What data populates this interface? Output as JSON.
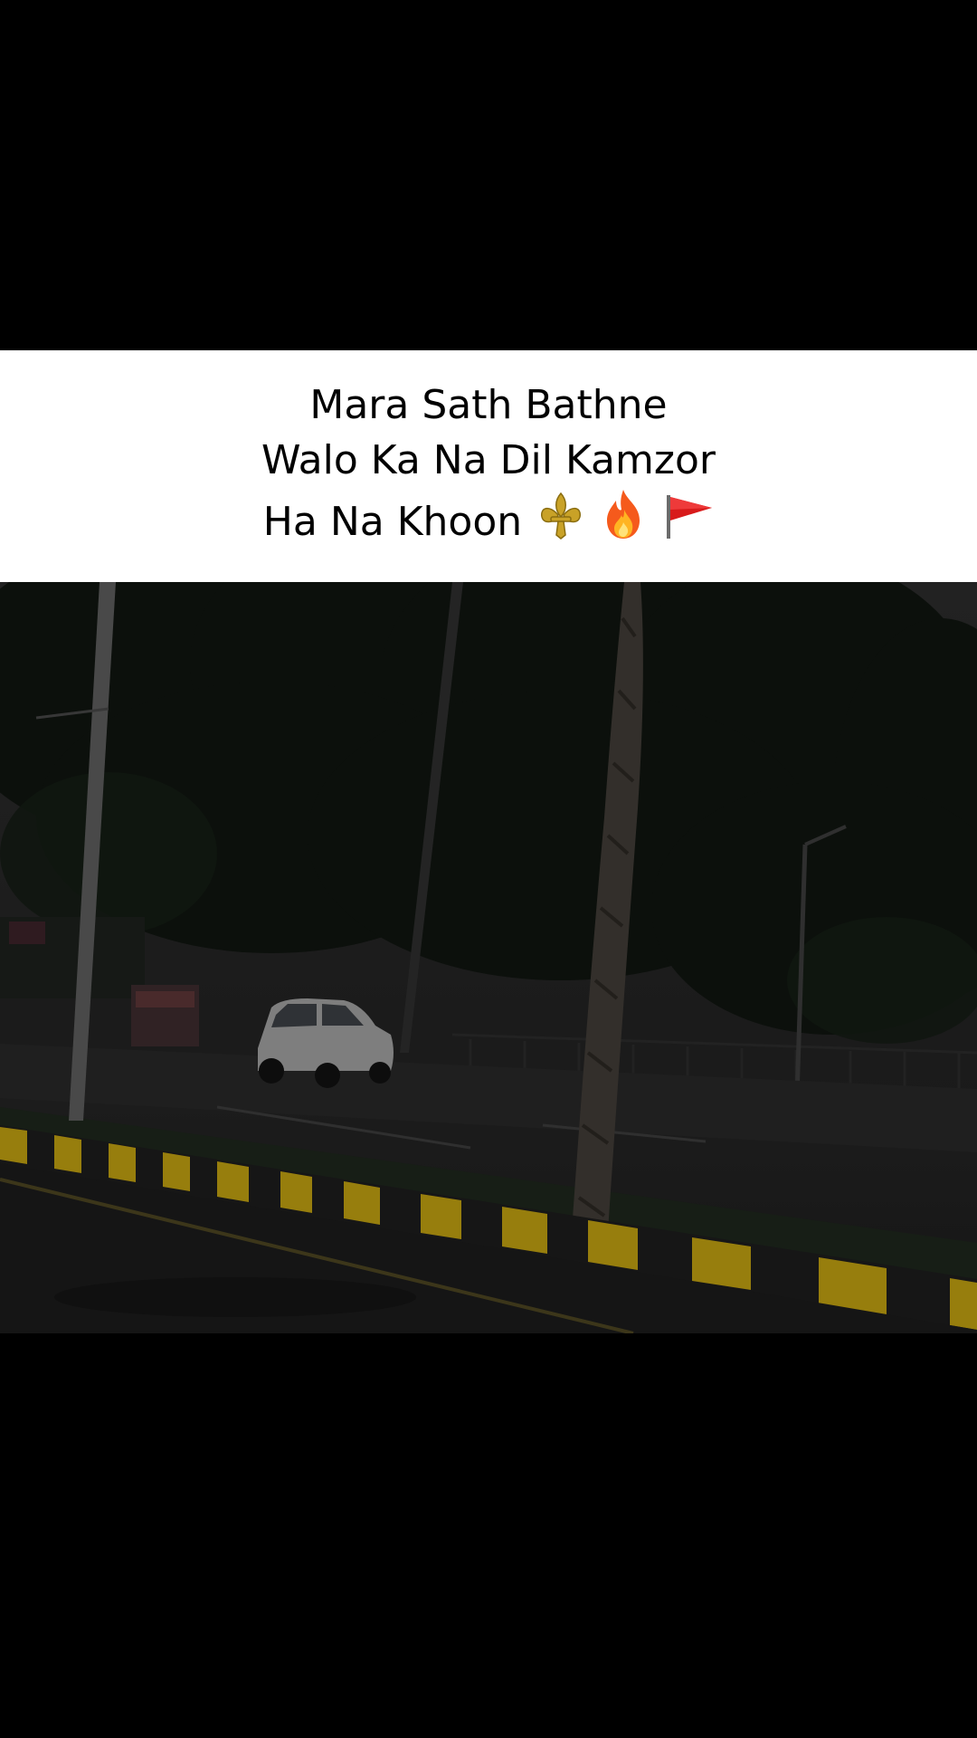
{
  "caption": {
    "lines": [
      "Mara Sath Bathne",
      "Walo Ka Na Dil Kamzor",
      "Ha Na Khoon"
    ],
    "emojis": [
      "fleur-de-lis-icon",
      "fire-icon",
      "red-flag-icon"
    ]
  },
  "photo": {
    "subject": "dark street scene with trees, parked white car and yellow-black striped curb"
  },
  "colors": {
    "background": "#000000",
    "caption_bg": "#ffffff",
    "curb_yellow": "#b99a10",
    "curb_black": "#111111"
  }
}
